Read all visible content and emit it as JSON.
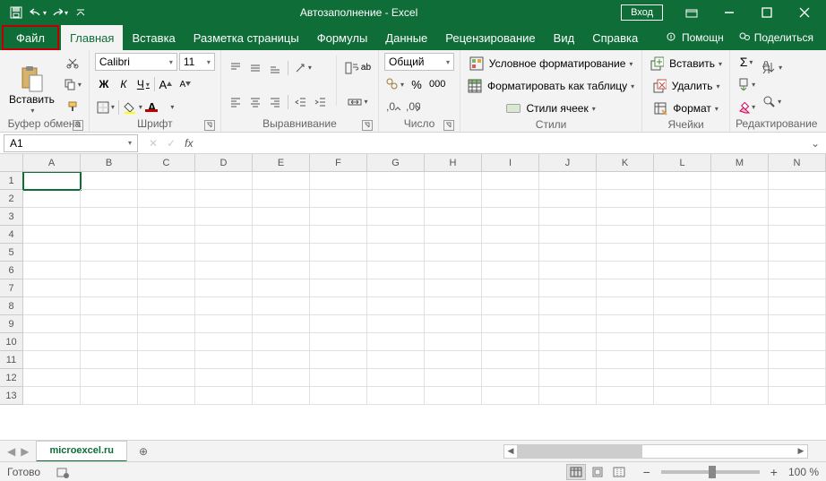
{
  "title": "Автозаполнение  -  Excel",
  "login": "Вход",
  "tabs": {
    "file": "Файл",
    "home": "Главная",
    "insert": "Вставка",
    "layout": "Разметка страницы",
    "formulas": "Формулы",
    "data": "Данные",
    "review": "Рецензирование",
    "view": "Вид",
    "help": "Справка"
  },
  "helpright": {
    "tell": "Помощн",
    "share": "Поделиться"
  },
  "clipboard": {
    "paste": "Вставить",
    "label": "Буфер обмена"
  },
  "font": {
    "name": "Calibri",
    "size": "11",
    "bold": "Ж",
    "italic": "К",
    "underline": "Ч",
    "label": "Шрифт"
  },
  "align": {
    "wrap": "ab",
    "label": "Выравнивание"
  },
  "number": {
    "format": "Общий",
    "label": "Число"
  },
  "styles": {
    "cond": "Условное форматирование",
    "table": "Форматировать как таблицу",
    "cell": "Стили ячеек",
    "label": "Стили"
  },
  "cells": {
    "insert": "Вставить",
    "delete": "Удалить",
    "format": "Формат",
    "label": "Ячейки"
  },
  "editing": {
    "label": "Редактирование"
  },
  "namebox": "A1",
  "columns": [
    "A",
    "B",
    "C",
    "D",
    "E",
    "F",
    "G",
    "H",
    "I",
    "J",
    "K",
    "L",
    "M",
    "N"
  ],
  "rows": [
    "1",
    "2",
    "3",
    "4",
    "5",
    "6",
    "7",
    "8",
    "9",
    "10",
    "11",
    "12",
    "13"
  ],
  "sheet": "microexcel.ru",
  "status": "Готово",
  "zoom": "100 %"
}
